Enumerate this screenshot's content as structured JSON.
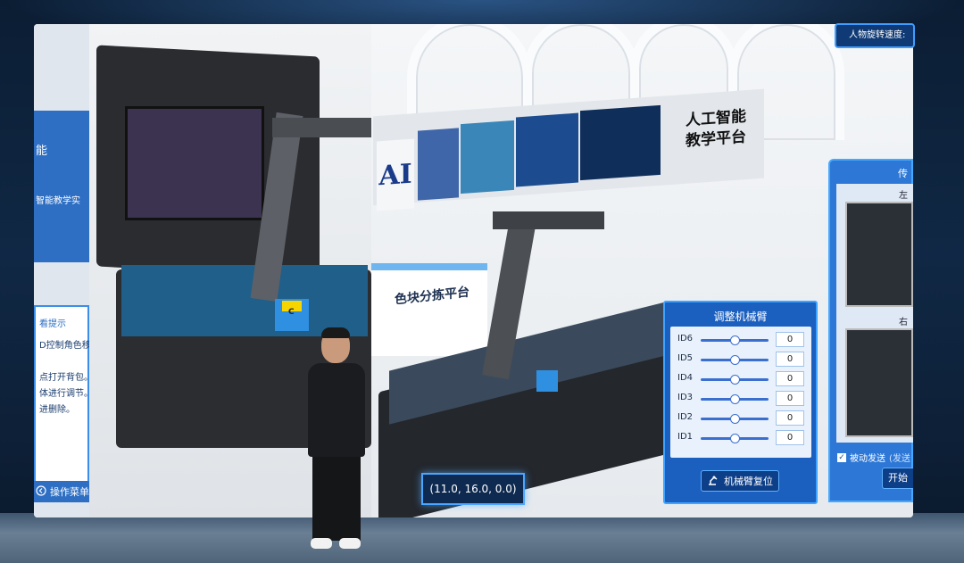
{
  "left_panel": {
    "card_title": "能",
    "card_subtitle": "智能教学实",
    "hint_title": "看提示",
    "hints": [
      "D控制角色移动",
      "点打开背包。",
      "体进行调节。",
      "进删除。"
    ],
    "menu_label": "操作菜单"
  },
  "showroom": {
    "banner_logo": "AI",
    "banner_title_line1": "人工智能",
    "banner_title_line2": "教学平台",
    "pedestal_label": "色块分拣平台",
    "cube_letter": "C"
  },
  "coordinates": "(11.0, 16.0, 0.0)",
  "arm_panel": {
    "title": "调整机械臂",
    "sliders": [
      {
        "id": "ID6",
        "value": "0",
        "level": 0.5
      },
      {
        "id": "ID5",
        "value": "0",
        "level": 0.5
      },
      {
        "id": "ID4",
        "value": "0",
        "level": 0.5
      },
      {
        "id": "ID3",
        "value": "0",
        "level": 0.5
      },
      {
        "id": "ID2",
        "value": "0",
        "level": 0.5
      },
      {
        "id": "ID1",
        "value": "0",
        "level": 0.5
      }
    ],
    "reset_label": "机械臂复位"
  },
  "right_panel": {
    "title": "传",
    "left_cam_label": "左",
    "right_cam_label": "右",
    "passive_send_label": "被动发送",
    "passive_send_note": "(发送",
    "passive_send_checked": true,
    "start_label": "开始"
  },
  "top_setting": {
    "label": "人物旋转速度:"
  },
  "colors": {
    "panel_blue": "#1b5fbf",
    "accent_border": "#3fa3ff",
    "button_navy": "#0d3e88"
  }
}
